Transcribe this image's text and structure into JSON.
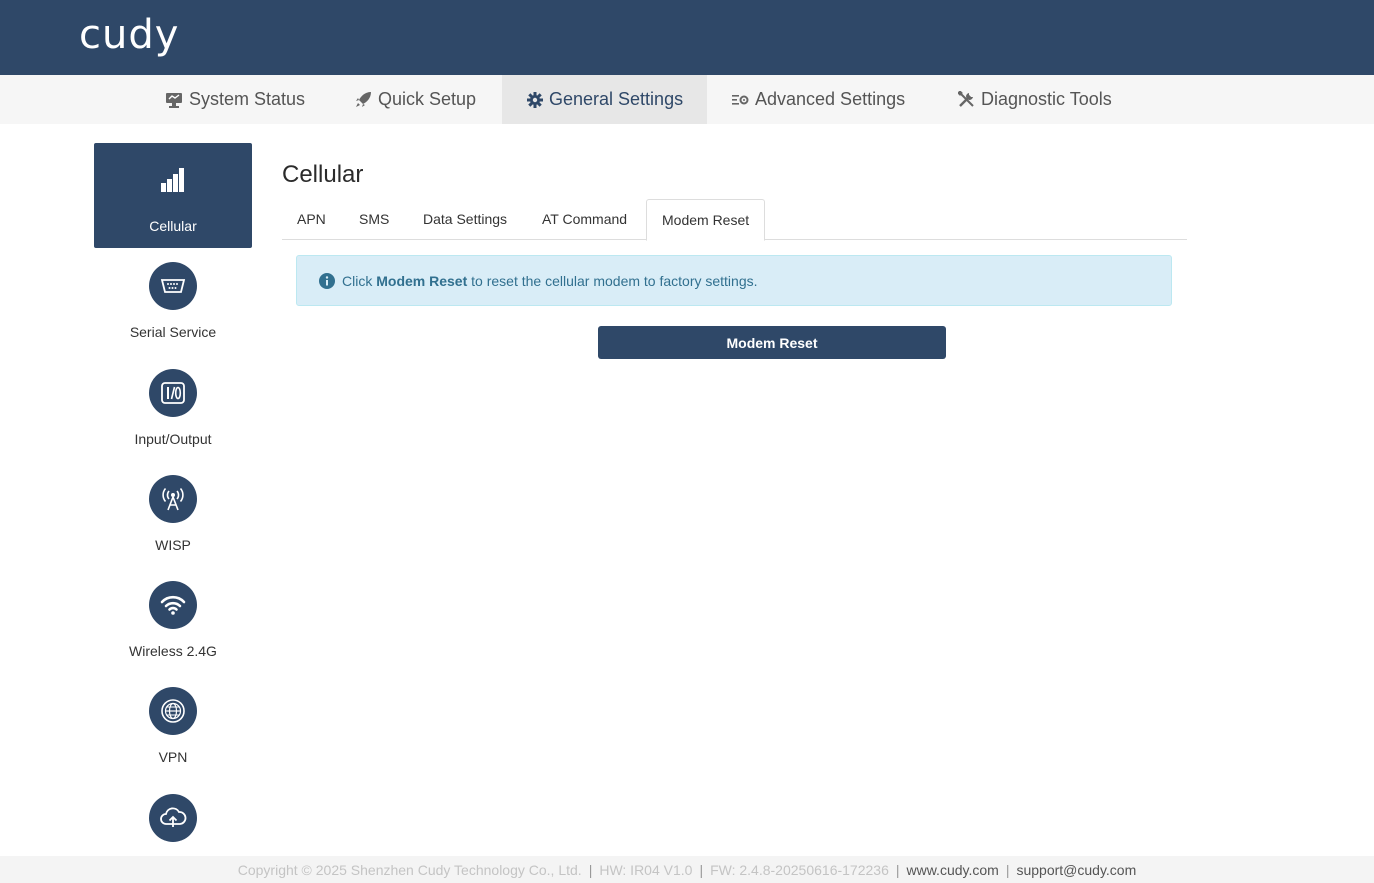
{
  "header": {
    "logo": "cudy"
  },
  "topnav": [
    {
      "label": "System Status",
      "icon": "monitor-icon"
    },
    {
      "label": "Quick Setup",
      "icon": "rocket-icon"
    },
    {
      "label": "General Settings",
      "icon": "gear-icon",
      "active": true
    },
    {
      "label": "Advanced Settings",
      "icon": "sliders-gear-icon"
    },
    {
      "label": "Diagnostic Tools",
      "icon": "tools-icon"
    }
  ],
  "sidebar": [
    {
      "label": "Cellular",
      "icon": "signal-bars-icon",
      "active": true
    },
    {
      "label": "Serial Service",
      "icon": "serial-port-icon"
    },
    {
      "label": "Input/Output",
      "icon": "io-icon"
    },
    {
      "label": "WISP",
      "icon": "antenna-icon"
    },
    {
      "label": "Wireless 2.4G",
      "icon": "wifi-icon"
    },
    {
      "label": "VPN",
      "icon": "globe-icon"
    },
    {
      "label": "",
      "icon": "cloud-upload-icon"
    }
  ],
  "main": {
    "title": "Cellular",
    "tabs": [
      {
        "label": "APN"
      },
      {
        "label": "SMS"
      },
      {
        "label": "Data Settings"
      },
      {
        "label": "AT Command"
      },
      {
        "label": "Modem Reset",
        "active": true
      }
    ],
    "alert": {
      "prefix": "Click",
      "strong": "Modem Reset",
      "suffix": "to reset the cellular modem to factory settings."
    },
    "button_label": "Modem Reset"
  },
  "footer": {
    "copyright": "Copyright © 2025 Shenzhen Cudy Technology Co., Ltd.",
    "hw": "HW: IR04 V1.0",
    "fw": "FW: 2.4.8-20250616-172236",
    "website": "www.cudy.com",
    "email": "support@cudy.com"
  },
  "colors": {
    "brand": "#2f4868",
    "alert_bg": "#d9edf7",
    "alert_text": "#31708f"
  }
}
